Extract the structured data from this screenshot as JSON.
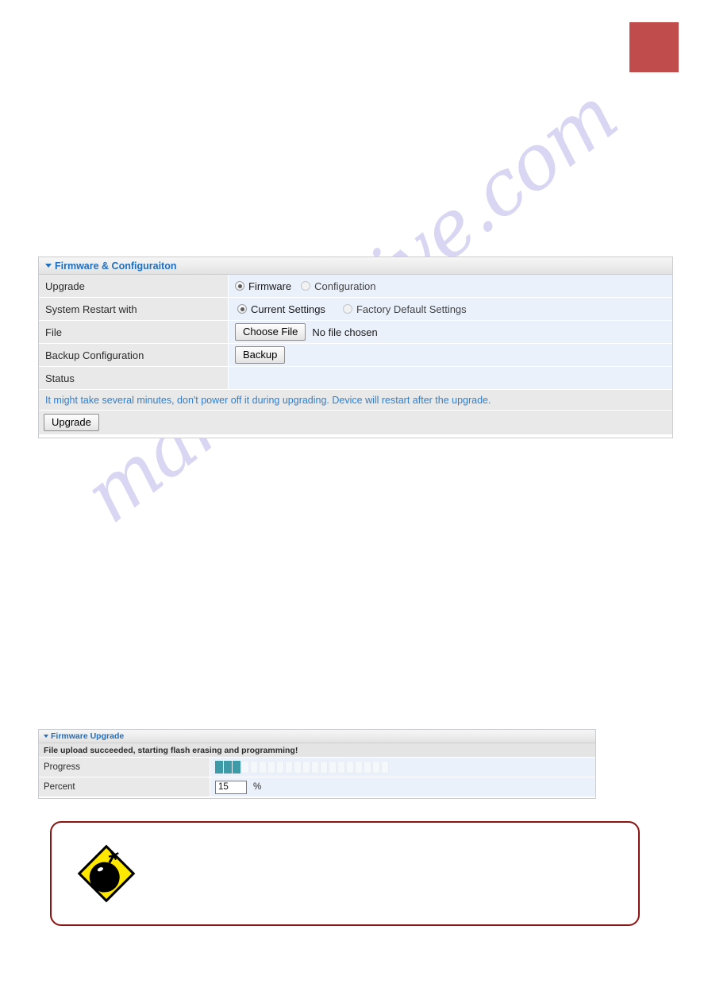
{
  "page": {
    "watermark_text": "manualshive.com",
    "corner_swatch_color": "#c04c4c"
  },
  "firmware_config_panel": {
    "title": "Firmware & Configuraiton",
    "caret_icon": "triangle-down-icon",
    "rows": [
      {
        "label": "Upgrade",
        "options": [
          {
            "text": "Firmware",
            "selected": true
          },
          {
            "text": "Configuration",
            "selected": false
          }
        ]
      },
      {
        "label": "System Restart with",
        "options": [
          {
            "text": "Current Settings",
            "selected": true
          },
          {
            "text": "Factory Default Settings",
            "selected": false
          }
        ]
      },
      {
        "label": "File",
        "choose_file_label": "Choose File",
        "file_status": "No file chosen"
      },
      {
        "label": "Backup Configuration",
        "backup_label": "Backup"
      },
      {
        "label": "Status",
        "value": ""
      }
    ],
    "note": "It might take several minutes, don't power off it during upgrading. Device will restart after the upgrade.",
    "note_color": "#2f7fcf",
    "upgrade_button_label": "Upgrade"
  },
  "firmware_upgrade_panel": {
    "title": "Firmware Upgrade",
    "caret_icon": "triangle-down-icon",
    "upload_message": "File upload succeeded, starting flash erasing and programming!",
    "progress_label": "Progress",
    "progress_segments_total": 20,
    "progress_segments_filled": 3,
    "progress_fill_color": "#3f9aa8",
    "percent_label": "Percent",
    "percent_value": "15",
    "percent_sign": "%"
  },
  "warning_callout": {
    "icon": "bomb-warning-icon",
    "border_color": "#8a1410",
    "text": ""
  }
}
